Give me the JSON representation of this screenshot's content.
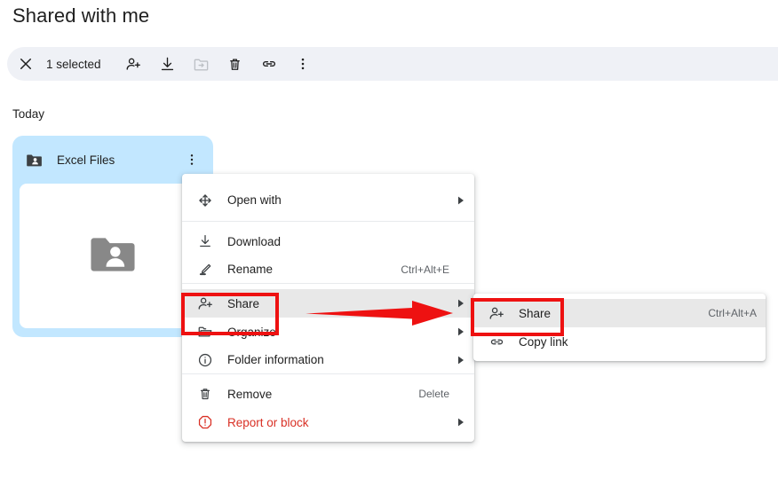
{
  "page": {
    "title": "Shared with me",
    "section_label": "Today"
  },
  "toolbar": {
    "close_label": "close-icon",
    "selected_count": "1 selected",
    "buttons": [
      {
        "name": "share-person-add-icon",
        "label": "Share",
        "disabled": false
      },
      {
        "name": "download-icon",
        "label": "Download",
        "disabled": false
      },
      {
        "name": "move-to-folder-icon",
        "label": "Move to folder",
        "disabled": true
      },
      {
        "name": "trash-icon",
        "label": "Remove",
        "disabled": false
      },
      {
        "name": "link-icon",
        "label": "Copy link",
        "disabled": false
      },
      {
        "name": "more-vert-icon",
        "label": "More actions",
        "disabled": false
      }
    ]
  },
  "card": {
    "title": "Excel Files",
    "more_label": "More options",
    "selected": true,
    "accent_color": "#c2e7ff",
    "thumb_color": "#888888"
  },
  "context_menu": {
    "items": [
      {
        "label": "Open with",
        "accel": "",
        "arrow": true,
        "highlighted": false,
        "danger": false,
        "icon": "open-with-move-icon"
      },
      {
        "label": "Download",
        "accel": "",
        "arrow": false,
        "highlighted": false,
        "danger": false,
        "icon": "download-icon"
      },
      {
        "label": "Rename",
        "accel": "Ctrl+Alt+E",
        "arrow": false,
        "highlighted": false,
        "danger": false,
        "icon": "rename-pencil-icon"
      },
      {
        "label": "Share",
        "accel": "",
        "arrow": true,
        "highlighted": true,
        "danger": false,
        "icon": "share-person-add-icon"
      },
      {
        "label": "Organize",
        "accel": "",
        "arrow": true,
        "highlighted": false,
        "danger": false,
        "icon": "organize-folder-icon"
      },
      {
        "label": "Folder information",
        "accel": "",
        "arrow": true,
        "highlighted": false,
        "danger": false,
        "icon": "info-circle-icon"
      },
      {
        "label": "Remove",
        "accel": "Delete",
        "arrow": false,
        "highlighted": false,
        "danger": false,
        "icon": "trash-icon"
      },
      {
        "label": "Report or block",
        "accel": "",
        "arrow": true,
        "highlighted": false,
        "danger": true,
        "icon": "report-warning-icon"
      }
    ]
  },
  "submenu": {
    "items": [
      {
        "label": "Share",
        "accel": "Ctrl+Alt+A",
        "highlighted": true,
        "icon": "share-person-add-icon"
      },
      {
        "label": "Copy link",
        "accel": "",
        "highlighted": false,
        "icon": "link-icon"
      }
    ]
  },
  "annotations": {
    "highlight_color": "#ee1111",
    "boxes": [
      "share-menu-item",
      "share-submenu-item"
    ],
    "arrow": "points-right-from-share-to-submenu"
  }
}
